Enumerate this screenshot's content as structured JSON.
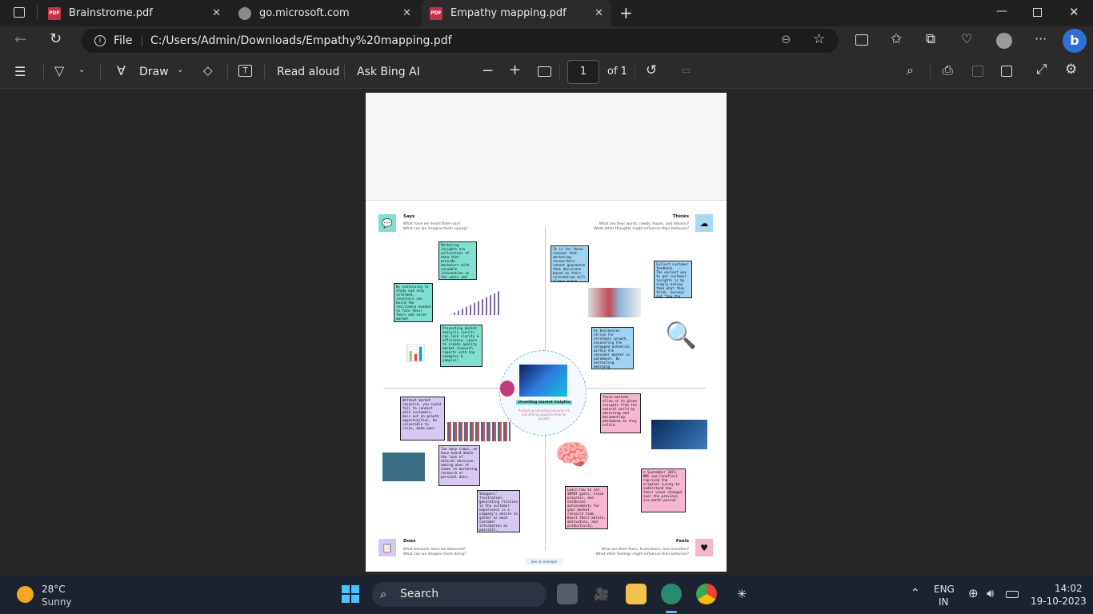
{
  "tabs": [
    {
      "title": "Brainstrome.pdf",
      "icon": "pdf-icon"
    },
    {
      "title": "go.microsoft.com",
      "icon": "edge-page-icon"
    },
    {
      "title": "Empathy mapping.pdf",
      "icon": "pdf-icon",
      "active": true
    }
  ],
  "address": {
    "scheme_label": "File",
    "url": "C:/Users/Admin/Downloads/Empathy%20mapping.pdf"
  },
  "pdf_toolbar": {
    "draw_label": "Draw",
    "read_aloud_label": "Read aloud",
    "ask_bing_label": "Ask Bing AI",
    "page_value": "1",
    "page_total": "of 1"
  },
  "empathy_map": {
    "says": {
      "title": "Says",
      "line1": "What have we heard them say?",
      "line2": "What can we imagine them saying?"
    },
    "thinks": {
      "title": "Thinks",
      "line1": "What are their wants, needs, hopes, and dreams?",
      "line2": "What other thoughts might influence their behavior?"
    },
    "does": {
      "title": "Does",
      "line1": "What behavior have we observed?",
      "line2": "What can we imagine them doing?"
    },
    "feels": {
      "title": "Feels",
      "line1": "What are their fears, frustrations, and anxieties?",
      "line2": "What other feelings might influence their behavior?"
    },
    "center_title": "Unveiling market insights",
    "center_subtitle": "Analyzing spending behaviors & identifying opportunities for growth",
    "see_example": "See an example",
    "notes": {
      "n1": "Marketing insights are collections of data that provide marketers with valuable information on the wants and needs of the brand's target demographic.",
      "n2": "By continuing to study and stay informed, investors can build the resilience needed to face their fears and seize market opportunities.",
      "n3": "Presenting market analysis results can lack clarity & efficiency. Learn to create quality market research reports with top examples & samples!",
      "n4": "It is for these reasons that marketing researchers cannot guarantee that decisions based on their information will always prove \"successful.\"",
      "n5": "Collect customer feedback. ... The easiest way to get customer insights is by simply asking them what they think. Surveys and \"how the thing .",
      "n6": "As businesses strive for strategic growth, uncovering the untapped potential within the consumer market is paramount. By extracting emerging",
      "n7": "Without market research, you could fail to connect with customers, miss out on growth opportunities, be vulnerable to risks, make poor",
      "n8": "Too many times, we have heard about the lack of ethical decision-making when it comes to marketing research or personal data.",
      "n9": "Shoppers' frustration-generating friction in the customer experience is a company's desire to gather as much customer information as possible.",
      "n10": "These methods allow us to glean insights from the natural world by observing and documenting phenomena as they unfold.",
      "n11": "n September 2021, NRG and Coneflect reprised the original survey to understand how their views changed over the previous six-month period",
      "n12": "Learn how to set SMART goals, track progress, and celebrate achievements for your market research team. Boost their morale, motivation, and productivity."
    }
  },
  "taskbar": {
    "weather_temp": "28°C",
    "weather_desc": "Sunny",
    "search_label": "Search",
    "lang_top": "ENG",
    "lang_bottom": "IN",
    "time": "14:02",
    "date": "19-10-2023"
  }
}
